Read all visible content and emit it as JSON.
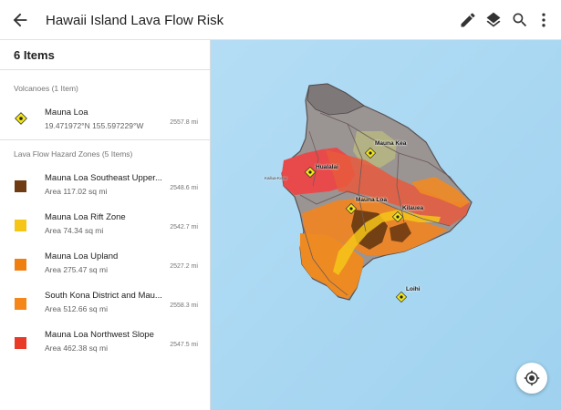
{
  "appbar": {
    "title": "Hawaii Island Lava Flow Risk",
    "icons": [
      "back-arrow-icon",
      "edit-pencil-icon",
      "layers-icon",
      "search-icon",
      "more-vert-icon"
    ]
  },
  "panel": {
    "count_label": "6 Items",
    "volcanoes_header": "Volcanoes (1 Item)",
    "volcano": {
      "name": "Mauna Loa",
      "coords": "19.471972°N  155.597229°W",
      "distance": "2557.8 mi"
    },
    "zones_header": "Lava Flow Hazard Zones (5 Items)",
    "zones": [
      {
        "name": "Mauna Loa Southeast Upper...",
        "area": "Area 117.02 sq mi",
        "distance": "2548.6 mi",
        "color": "#6e3b12"
      },
      {
        "name": "Mauna Loa Rift Zone",
        "area": "Area 74.34 sq mi",
        "distance": "2542.7 mi",
        "color": "#f5c518"
      },
      {
        "name": "Mauna Loa Upland",
        "area": "Area 275.47 sq mi",
        "distance": "2527.2 mi",
        "color": "#f07f12"
      },
      {
        "name": "South Kona District and Mau...",
        "area": "Area 512.66 sq mi",
        "distance": "2558.3 mi",
        "color": "#f4861a"
      },
      {
        "name": "Mauna Loa Northwest Slope",
        "area": "Area 462.38 sq mi",
        "distance": "2547.5 mi",
        "color": "#e83a26"
      }
    ]
  },
  "map": {
    "labels": {
      "mauna_kea": "Mauna Kea",
      "hualalai": "Hualalai",
      "kailua_kona": "Kailua-Kona",
      "mauna_loa": "Mauna Loa",
      "kilauea": "Kilauea",
      "loihi": "Loihi"
    },
    "ocean_color": "#a5d6f2"
  }
}
